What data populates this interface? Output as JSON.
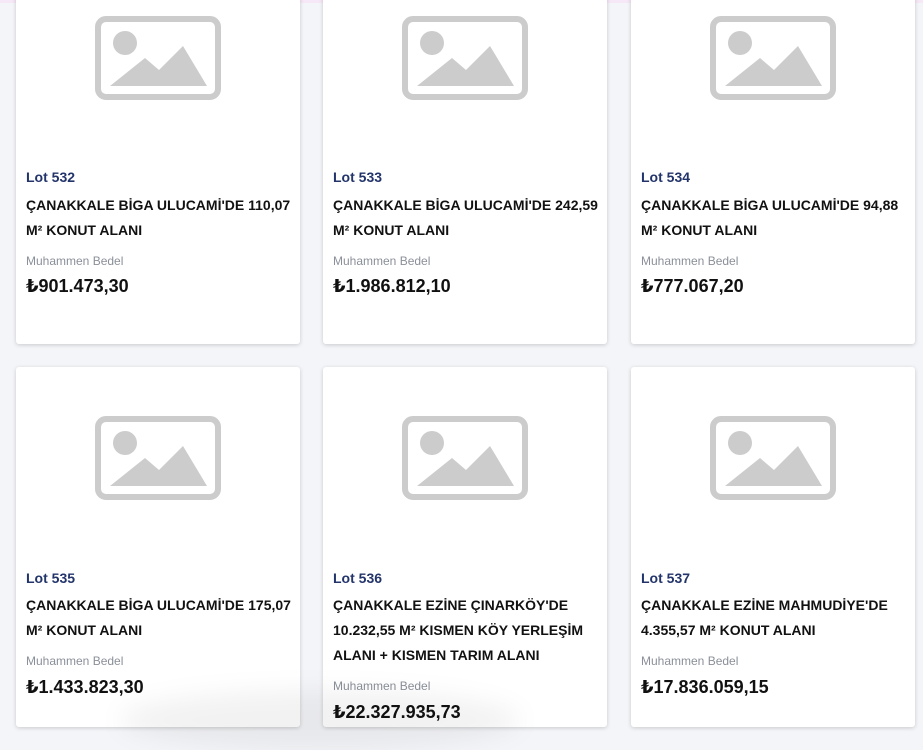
{
  "icons": {
    "placeholder": "image-placeholder-icon"
  },
  "colors": {
    "lot": "#23346b",
    "price": "#111111",
    "label": "#8a8f98",
    "placeholder": "#cccccc"
  },
  "cards": [
    {
      "lot": "Lot 532",
      "title": "ÇANAKKALE BİGA ULUCAMİ'DE 110,07 M² KONUT ALANI",
      "price_label": "Muhammen Bedel",
      "price": "₺901.473,30"
    },
    {
      "lot": "Lot 533",
      "title": "ÇANAKKALE BİGA ULUCAMİ'DE 242,59 M² KONUT ALANI",
      "price_label": "Muhammen Bedel",
      "price": "₺1.986.812,10"
    },
    {
      "lot": "Lot 534",
      "title": "ÇANAKKALE BİGA ULUCAMİ'DE 94,88 M² KONUT ALANI",
      "price_label": "Muhammen Bedel",
      "price": "₺777.067,20"
    },
    {
      "lot": "Lot 535",
      "title": "ÇANAKKALE BİGA ULUCAMİ'DE 175,07 M² KONUT ALANI",
      "price_label": "Muhammen Bedel",
      "price": "₺1.433.823,30"
    },
    {
      "lot": "Lot 536",
      "title": "ÇANAKKALE EZİNE ÇINARKÖY'DE 10.232,55 M² KISMEN KÖY YERLEŞİM ALANI + KISMEN TARIM ALANI",
      "price_label": "Muhammen Bedel",
      "price": "₺22.327.935,73"
    },
    {
      "lot": "Lot 537",
      "title": "ÇANAKKALE EZİNE MAHMUDİYE'DE 4.355,57 M² KONUT ALANI",
      "price_label": "Muhammen Bedel",
      "price": "₺17.836.059,15"
    }
  ]
}
